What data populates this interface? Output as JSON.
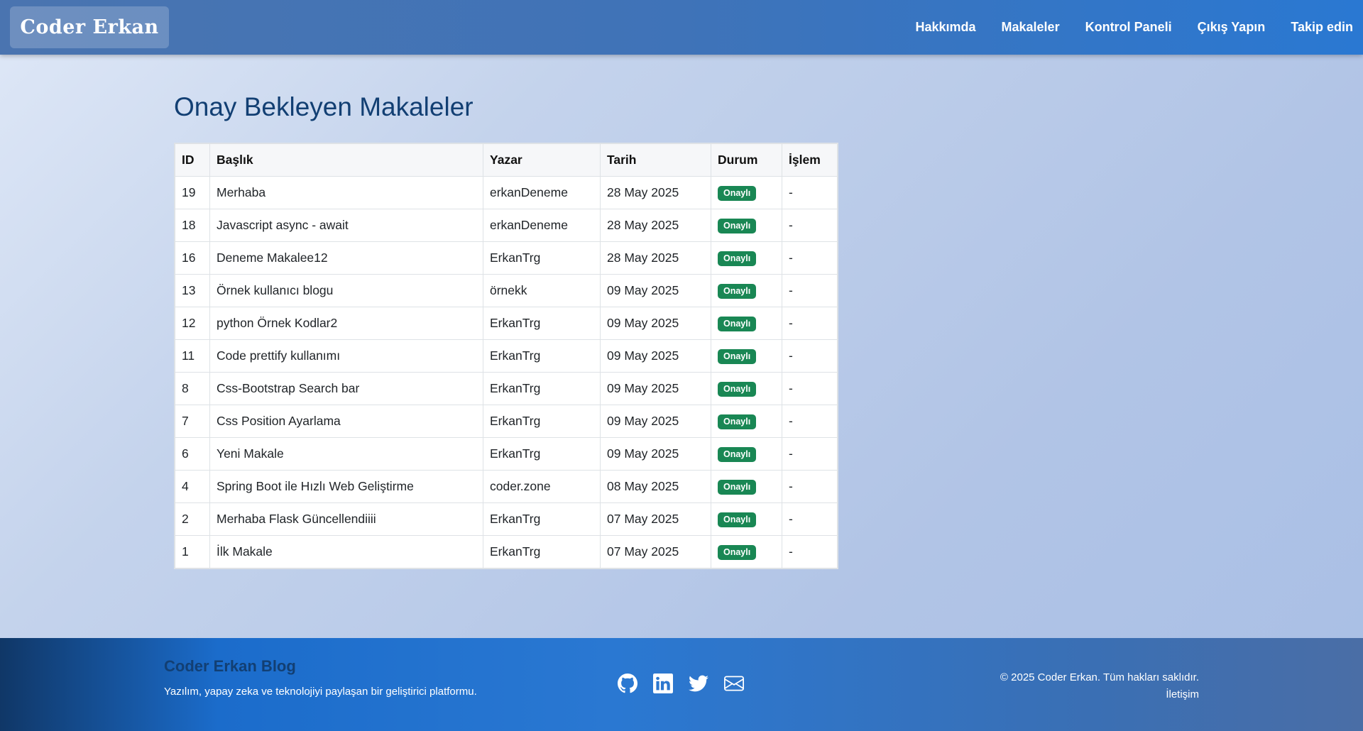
{
  "navbar": {
    "brand": "Coder Erkan",
    "links": [
      "Hakkımda",
      "Makaleler",
      "Kontrol Paneli",
      "Çıkış Yapın",
      "Takip edin"
    ]
  },
  "main": {
    "title": "Onay Bekleyen Makaleler",
    "table": {
      "headers": [
        "ID",
        "Başlık",
        "Yazar",
        "Tarih",
        "Durum",
        "İşlem"
      ],
      "rows": [
        {
          "id": "19",
          "title": "Merhaba",
          "author": "erkanDeneme",
          "date": "28 May 2025",
          "status": "Onaylı",
          "action": "-"
        },
        {
          "id": "18",
          "title": "Javascript async - await",
          "author": "erkanDeneme",
          "date": "28 May 2025",
          "status": "Onaylı",
          "action": "-"
        },
        {
          "id": "16",
          "title": "Deneme Makalee12",
          "author": "ErkanTrg",
          "date": "28 May 2025",
          "status": "Onaylı",
          "action": "-"
        },
        {
          "id": "13",
          "title": "Örnek kullanıcı blogu",
          "author": "örnekk",
          "date": "09 May 2025",
          "status": "Onaylı",
          "action": "-"
        },
        {
          "id": "12",
          "title": "python Örnek Kodlar2",
          "author": "ErkanTrg",
          "date": "09 May 2025",
          "status": "Onaylı",
          "action": "-"
        },
        {
          "id": "11",
          "title": "Code prettify kullanımı",
          "author": "ErkanTrg",
          "date": "09 May 2025",
          "status": "Onaylı",
          "action": "-"
        },
        {
          "id": "8",
          "title": "Css-Bootstrap Search bar",
          "author": "ErkanTrg",
          "date": "09 May 2025",
          "status": "Onaylı",
          "action": "-"
        },
        {
          "id": "7",
          "title": "Css Position Ayarlama",
          "author": "ErkanTrg",
          "date": "09 May 2025",
          "status": "Onaylı",
          "action": "-"
        },
        {
          "id": "6",
          "title": "Yeni Makale",
          "author": "ErkanTrg",
          "date": "09 May 2025",
          "status": "Onaylı",
          "action": "-"
        },
        {
          "id": "4",
          "title": "Spring Boot ile Hızlı Web Geliştirme",
          "author": "coder.zone",
          "date": "08 May 2025",
          "status": "Onaylı",
          "action": "-"
        },
        {
          "id": "2",
          "title": "Merhaba Flask Güncellendiiii",
          "author": "ErkanTrg",
          "date": "07 May 2025",
          "status": "Onaylı",
          "action": "-"
        },
        {
          "id": "1",
          "title": "İlk Makale",
          "author": "ErkanTrg",
          "date": "07 May 2025",
          "status": "Onaylı",
          "action": "-"
        }
      ]
    }
  },
  "footer": {
    "brand": "Coder Erkan Blog",
    "description": "Yazılım, yapay zeka ve teknolojiyi paylaşan bir geliştirici platformu.",
    "social_icons": [
      "github-icon",
      "linkedin-icon",
      "twitter-icon",
      "mail-icon"
    ],
    "copyright": "© 2025 Coder Erkan. Tüm hakları saklıdır.",
    "contact_link": "İletişim"
  },
  "colors": {
    "navbar_accent": "#2a78d2",
    "title": "#123f73",
    "badge_success": "#198754"
  }
}
